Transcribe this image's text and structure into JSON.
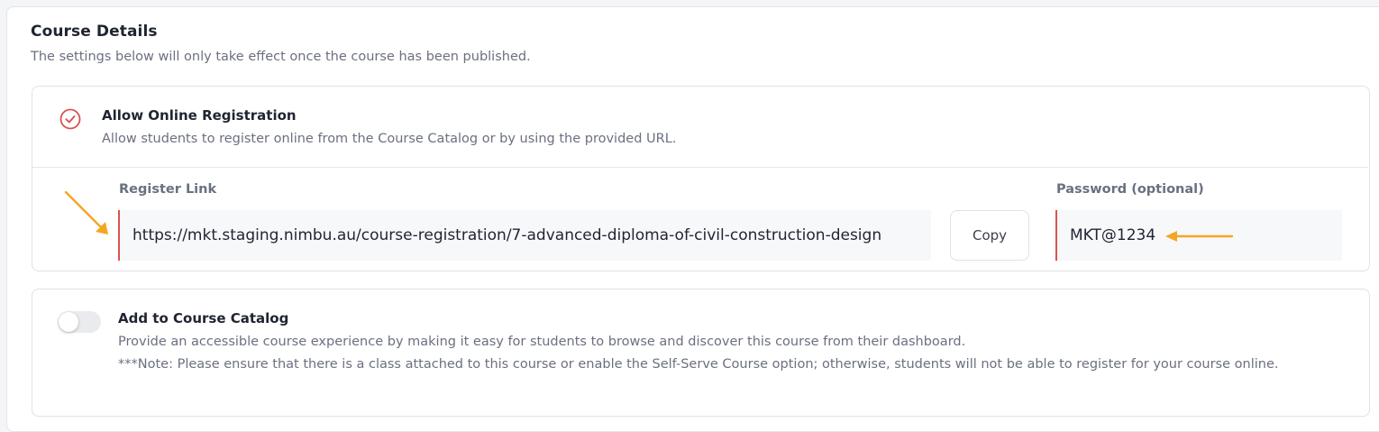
{
  "section": {
    "title": "Course Details",
    "description": "The settings below will only take effect once the course has been published."
  },
  "online_registration": {
    "enabled": true,
    "title": "Allow Online Registration",
    "description": "Allow students to register online from the Course Catalog or by using the provided URL.",
    "register_link_label": "Register Link",
    "register_link_value": "https://mkt.staging.nimbu.au/course-registration/7-advanced-diploma-of-civil-construction-design",
    "copy_label": "Copy",
    "password_label": "Password (optional)",
    "password_value": "MKT@1234"
  },
  "course_catalog": {
    "enabled": false,
    "title": "Add to Course Catalog",
    "description": "Provide an accessible course experience by making it easy for students to browse and discover this course from their dashboard.",
    "note": "***Note: Please ensure that there is a class attached to this course or enable the Self-Serve Course option; otherwise, students will not be able to register for your course online."
  },
  "colors": {
    "accent_red": "#d9534f",
    "annotation_arrow": "#f5a623"
  },
  "icons": {
    "registration_check": "check-circle-icon",
    "annotation": "arrow-icon"
  }
}
